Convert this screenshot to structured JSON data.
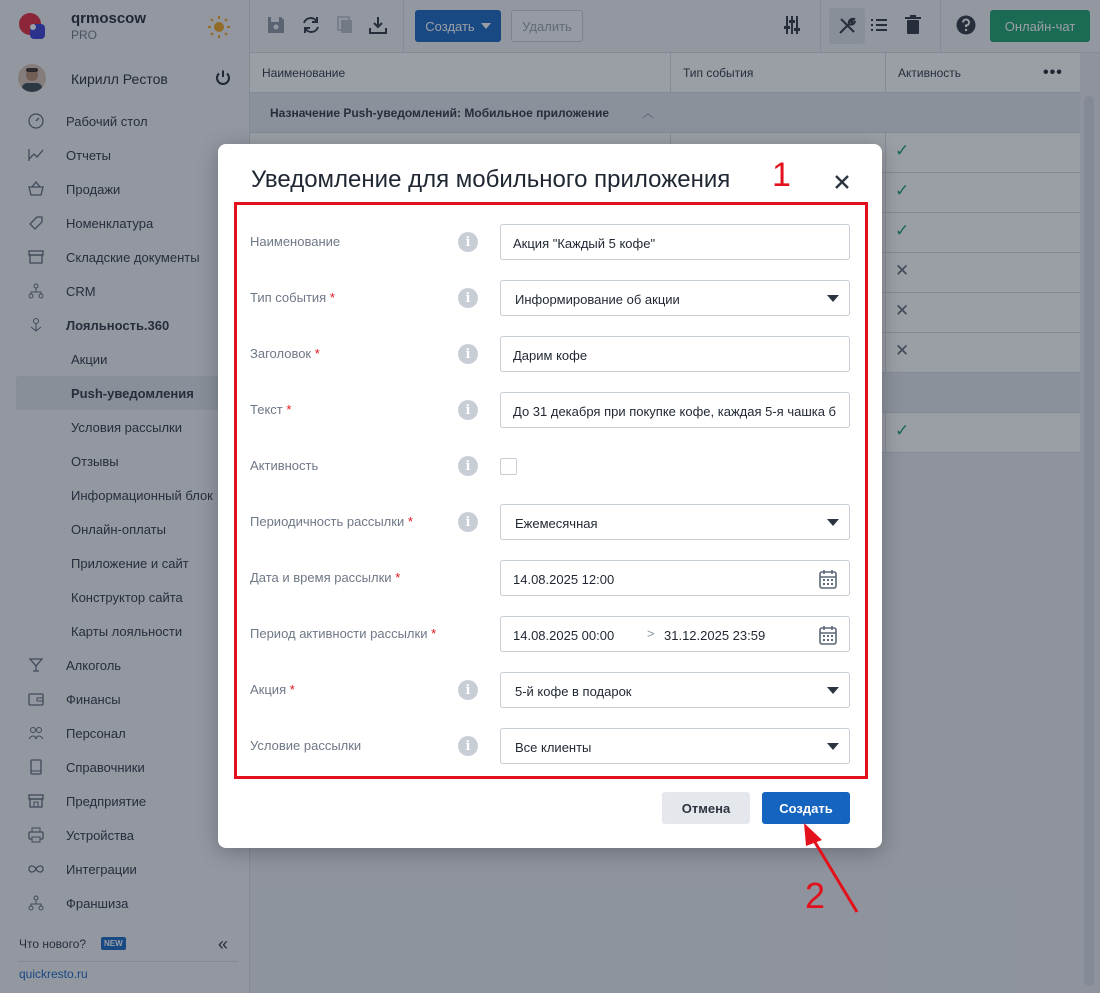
{
  "brand": {
    "name": "qrmoscow",
    "plan": "PRO"
  },
  "user": {
    "name": "Кирилл Рестов"
  },
  "nav": [
    {
      "label": "Рабочий стол",
      "icon": "dashboard-icon"
    },
    {
      "label": "Отчеты",
      "icon": "chart-icon"
    },
    {
      "label": "Продажи",
      "icon": "basket-icon"
    },
    {
      "label": "Номенклатура",
      "icon": "tag-icon"
    },
    {
      "label": "Складские документы",
      "icon": "archive-icon"
    },
    {
      "label": "CRM",
      "icon": "hierarchy-icon"
    },
    {
      "label": "Лояльность.360",
      "icon": "loyalty-icon"
    },
    {
      "label": "Акции"
    },
    {
      "label": "Push-уведомления"
    },
    {
      "label": "Условия рассылки"
    },
    {
      "label": "Отзывы"
    },
    {
      "label": "Информационный блок"
    },
    {
      "label": "Онлайн-оплаты"
    },
    {
      "label": "Приложение и сайт"
    },
    {
      "label": "Конструктор сайта"
    },
    {
      "label": "Карты лояльности"
    },
    {
      "label": "Алкоголь",
      "icon": "glass-icon"
    },
    {
      "label": "Финансы",
      "icon": "wallet-icon"
    },
    {
      "label": "Персонал",
      "icon": "people-icon"
    },
    {
      "label": "Справочники",
      "icon": "book-icon"
    },
    {
      "label": "Предприятие",
      "icon": "store-icon"
    },
    {
      "label": "Устройства",
      "icon": "printer-icon"
    },
    {
      "label": "Интеграции",
      "icon": "infinity-icon"
    },
    {
      "label": "Франшиза",
      "icon": "hierarchy-icon"
    }
  ],
  "sidebar_bottom": {
    "whats_new": "Что нового?",
    "badge": "NEW",
    "collapse": "«",
    "site": "quickresto.ru"
  },
  "toolbar": {
    "create_label": "Создать",
    "delete_label": "Удалить",
    "chat_label": "Онлайн-чат"
  },
  "table": {
    "columns": [
      "Наименование",
      "Тип события",
      "Активность"
    ],
    "more": "•••",
    "group_label": "Назначение Push-уведомлений: Мобильное приложение",
    "group_chevron": "︿",
    "rows": [
      "✓",
      "✓",
      "✓",
      "✕",
      "✕",
      "✕"
    ],
    "last_row": "✓"
  },
  "modal": {
    "title": "Уведомление для мобильного приложения",
    "annotation_1": "1",
    "annotation_2": "2",
    "info_symbol": "i",
    "fields": {
      "name": {
        "label": "Наименование",
        "value": "Акция \"Каждый 5 кофе\""
      },
      "event_type": {
        "label": "Тип события",
        "value": "Информирование об акции"
      },
      "headline": {
        "label": "Заголовок",
        "value": "Дарим кофе"
      },
      "text": {
        "label": "Текст",
        "value": "До 31 декабря при покупке кофе, каждая 5-я чашка б"
      },
      "active": {
        "label": "Активность",
        "checked": false
      },
      "periodicity": {
        "label": "Периодичность рассылки",
        "value": "Ежемесячная"
      },
      "send_datetime": {
        "label": "Дата и время рассылки",
        "value": "14.08.2025 12:00"
      },
      "active_period": {
        "label": "Период активности рассылки",
        "from": "14.08.2025 00:00",
        "separator": ">",
        "to": "31.12.2025 23:59"
      },
      "promo": {
        "label": "Акция",
        "value": "5-й кофе в подарок"
      },
      "condition": {
        "label": "Условие рассылки",
        "value": "Все клиенты"
      }
    },
    "required_mark": "*",
    "cancel_label": "Отмена",
    "submit_label": "Создать"
  },
  "colors": {
    "accent": "#1565c0",
    "success": "#18a06a",
    "annotation": "#e3111b"
  }
}
